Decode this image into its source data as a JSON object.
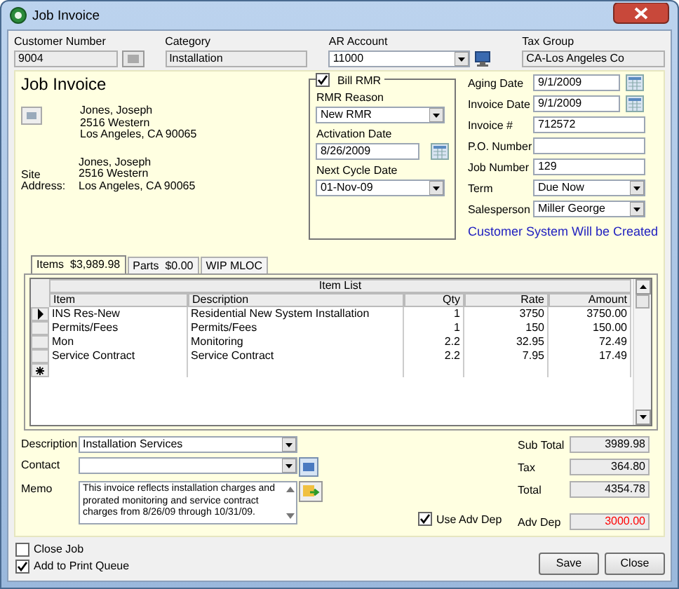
{
  "window": {
    "title": "Job Invoice"
  },
  "header_fields": [
    {
      "label": "Customer Number",
      "value": "9004",
      "kind": "readonly-button"
    },
    {
      "label": "Category",
      "value": "Installation",
      "kind": "readonly"
    },
    {
      "label": "AR Account",
      "value": "11000",
      "kind": "dropdown-button"
    },
    {
      "label": "Tax Group",
      "value": "CA-Los Angeles Co",
      "kind": "readonly"
    }
  ],
  "heading": "Job Invoice",
  "billing_address": [
    "Jones, Joseph",
    "2516 Western",
    "Los Angeles, CA  90065"
  ],
  "site_address": {
    "label": "Site Address:",
    "lines": [
      "Jones, Joseph",
      "2516 Western",
      "Los Angeles, CA  90065"
    ]
  },
  "rmr": {
    "label": "Bill RMR",
    "checked": true,
    "fields": [
      {
        "label": "RMR Reason",
        "value": "New RMR",
        "kind": "dropdown"
      },
      {
        "label": "Activation Date",
        "value": "8/26/2009",
        "kind": "date"
      },
      {
        "label": "Next Cycle Date",
        "value": "01-Nov-09",
        "kind": "dropdown"
      }
    ]
  },
  "details": [
    {
      "label": "Aging Date",
      "value": "9/1/2009",
      "kind": "date"
    },
    {
      "label": "Invoice Date",
      "value": "9/1/2009",
      "kind": "date"
    },
    {
      "label": "Invoice #",
      "value": "712572",
      "kind": "text"
    },
    {
      "label": "P.O. Number",
      "kind": "text"
    },
    {
      "label": "Job Number",
      "value": "129",
      "kind": "text"
    },
    {
      "label": "Term",
      "value": "Due Now",
      "kind": "dropdown"
    },
    {
      "label": "Salesperson",
      "value": "Miller George",
      "kind": "dropdown"
    }
  ],
  "notice": "Customer System Will be Created",
  "tabs": [
    {
      "label": "Items",
      "amount": "$3,989.98",
      "selected": true
    },
    {
      "label": "Parts",
      "amount": "$0.00",
      "selected": false
    },
    {
      "label": "WIP MLOC",
      "selected": false
    }
  ],
  "grid": {
    "title": "Item List",
    "columns": [
      "Item",
      "Description",
      "Qty",
      "Rate",
      "Amount"
    ],
    "rows": [
      {
        "current": true,
        "cells": [
          "INS Res-New",
          "Residential New System Installation",
          "1",
          "3750",
          "3750.00"
        ]
      },
      {
        "current": false,
        "cells": [
          "Permits/Fees",
          "Permits/Fees",
          "1",
          "150",
          "150.00"
        ]
      },
      {
        "current": false,
        "cells": [
          "Mon",
          "Monitoring",
          "2.2",
          "32.95",
          "72.49"
        ]
      },
      {
        "current": false,
        "cells": [
          "Service Contract",
          "Service Contract",
          "2.2",
          "7.95",
          "17.49"
        ]
      }
    ]
  },
  "bottom_fields": [
    {
      "label": "Description",
      "value": "Installation Services",
      "kind": "dropdown"
    },
    {
      "label": "Contact",
      "kind": "dropdown-button"
    },
    {
      "label": "Memo",
      "value": "This invoice reflects installation charges and prorated monitoring and service contract charges from 8/26/09 through 10/31/09.",
      "kind": "memo"
    }
  ],
  "use_adv_dep": {
    "label": "Use Adv Dep",
    "checked": true
  },
  "totals": [
    {
      "label": "Sub Total",
      "value": "3989.98",
      "color": "#000000"
    },
    {
      "label": "Tax",
      "value": "364.80",
      "color": "#000000"
    },
    {
      "label": "Total",
      "value": "4354.78",
      "color": "#000000"
    },
    {
      "label": "Adv Dep",
      "value": "3000.00",
      "color": "#ff0000"
    }
  ],
  "options": [
    {
      "label": "Close Job",
      "checked": false
    },
    {
      "label": "Add to Print Queue",
      "checked": true
    }
  ],
  "buttons": [
    "Save",
    "Close"
  ]
}
